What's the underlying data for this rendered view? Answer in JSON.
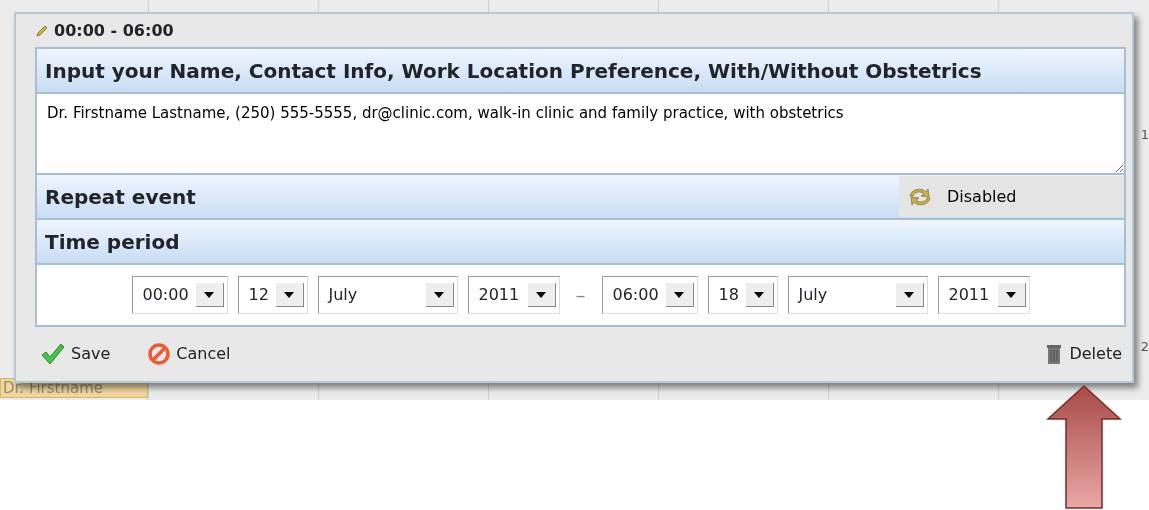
{
  "calendar": {
    "events": [
      {
        "label": "Dr. Firstname"
      }
    ],
    "day_numbers": [
      "1",
      "2"
    ]
  },
  "dialog": {
    "title": "00:00 - 06:00",
    "sections": [
      {
        "kind": "text",
        "heading": "Input your Name, Contact Info, Work Location Preference, With/Without Obstetrics",
        "value": "Dr. Firstname Lastname, (250) 555-5555, dr@clinic.com, walk-in clinic and family practice, with obstetrics"
      },
      {
        "kind": "toggle",
        "heading": "Repeat event",
        "status": "Disabled"
      },
      {
        "kind": "range",
        "heading": "Time period",
        "start": {
          "time": "00:00",
          "day": "12",
          "month": "July",
          "year": "2011"
        },
        "separator": "–",
        "end": {
          "time": "06:00",
          "day": "18",
          "month": "July",
          "year": "2011"
        }
      }
    ],
    "buttons": [
      {
        "kind": "save",
        "label": "Save"
      },
      {
        "kind": "cancel",
        "label": "Cancel"
      },
      {
        "kind": "delete",
        "label": "Delete"
      }
    ]
  }
}
